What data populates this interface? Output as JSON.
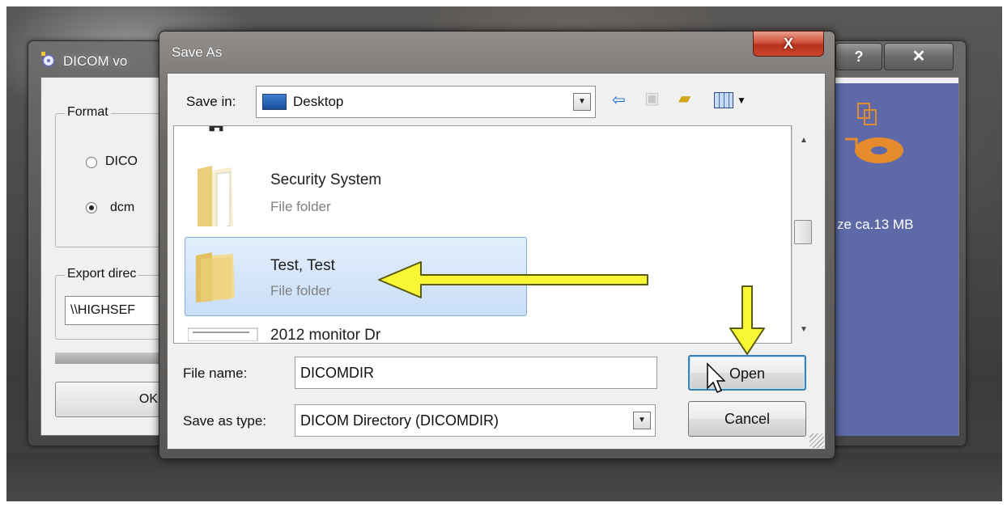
{
  "back_window": {
    "title": "DICOM vo",
    "help_label": "?",
    "close_label": "✕",
    "format_group": "Format",
    "radio_dicom": "DICO",
    "radio_dcm": "dcm",
    "export_group": "Export direc",
    "export_dir_value": "\\\\HIGHSEF",
    "ok_label": "OK",
    "size_text": "ze ca.13 MB"
  },
  "dialog": {
    "title": "Save As",
    "close_label": "X",
    "save_in_label": "Save in:",
    "save_in_value": "Desktop",
    "files": [
      {
        "name": "",
        "type": ""
      },
      {
        "name": "Security System",
        "type": "File folder"
      },
      {
        "name": "Test, Test",
        "type": "File folder"
      },
      {
        "name": "2012 monitor Dr",
        "type": ""
      }
    ],
    "file_name_label": "File name:",
    "file_name_value": "DICOMDIR",
    "save_as_type_label": "Save as type:",
    "save_as_type_value": "DICOM Directory (DICOMDIR)",
    "open_label": "Open",
    "cancel_label": "Cancel"
  },
  "colors": {
    "annotation_arrow": "#f7f733",
    "selection": "#c9def7",
    "close_button": "#c9452c"
  }
}
